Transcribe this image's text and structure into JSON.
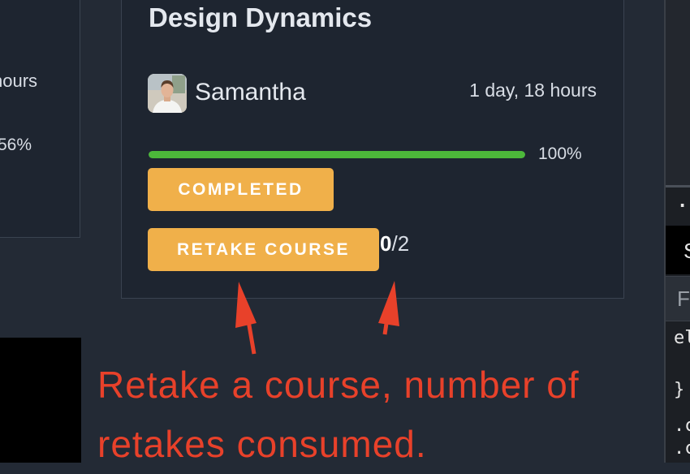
{
  "left_card": {
    "duration_partial": "hours",
    "progress_label": "56%"
  },
  "course": {
    "title": "Design Dynamics",
    "author": "Samantha",
    "duration": "1 day, 18 hours",
    "progress_percent": 100,
    "progress_label": "100%",
    "status_label": "COMPLETED",
    "retake_label": "RETAKE COURSE",
    "retakes_used": "0",
    "retakes_total": "/2"
  },
  "editor_pane": {
    "ellipsis": "..",
    "s_char": "S",
    "f_char": "F",
    "code_lines": [
      "el",
      "}",
      ".c",
      ".c"
    ]
  },
  "annotation": {
    "text": "Retake a course, number of retakes consumed."
  },
  "colors": {
    "accent_button": "#f0b04a",
    "progress_fill": "#4cb83a",
    "annotation": "#e8412a",
    "card_bg": "#1e2530",
    "page_bg": "#232a35"
  }
}
